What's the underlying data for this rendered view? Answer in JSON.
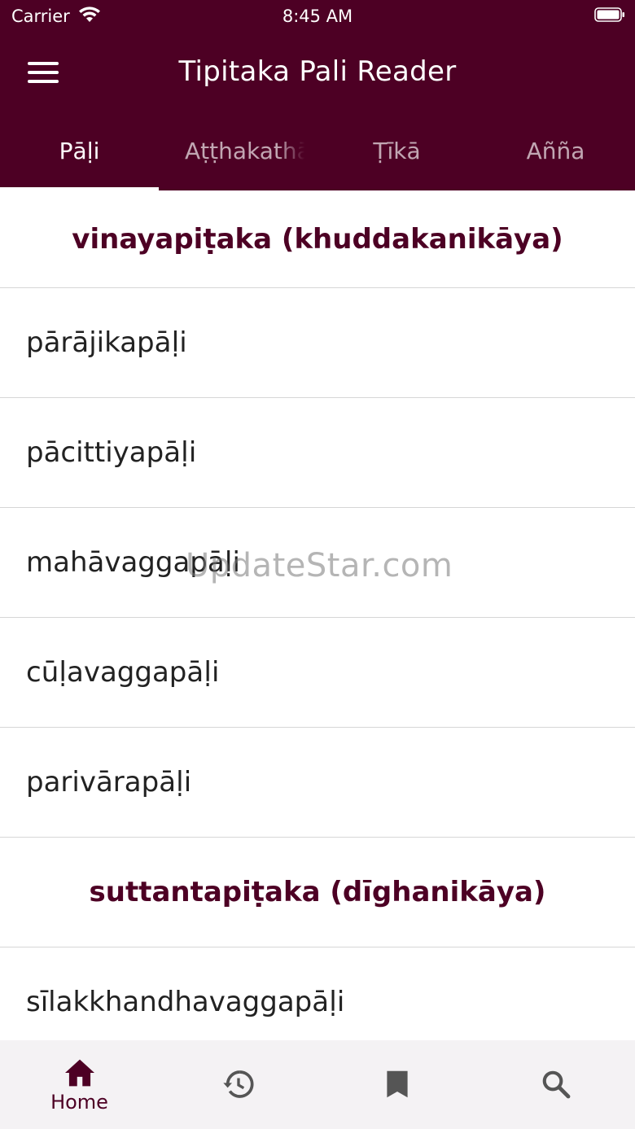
{
  "status_bar": {
    "carrier": "Carrier",
    "time": "8:45 AM",
    "icons": [
      "wifi-icon",
      "battery-icon"
    ]
  },
  "app_bar": {
    "title": "Tipitaka Pali Reader",
    "menu_icon": "hamburger-menu-icon"
  },
  "tabs": [
    {
      "label": "Pāḷi",
      "active": true
    },
    {
      "label": "Aṭṭhakathā",
      "active": false
    },
    {
      "label": "Ṭīkā",
      "active": false
    },
    {
      "label": "Añña",
      "active": false
    }
  ],
  "sections": [
    {
      "header": "vinayapiṭaka (khuddakanikāya)",
      "items": [
        "pārājikapāḷi",
        "pācittiyapāḷi",
        "mahāvaggapāḷi",
        "cūḷavaggapāḷi",
        "parivārapāḷi"
      ]
    },
    {
      "header": "suttantapiṭaka (dīghanikāya)",
      "items": [
        "sīlakkhandhavaggapāḷi"
      ]
    }
  ],
  "watermark": "UpdateStar.com",
  "bottom_nav": {
    "home_label": "Home",
    "icons": [
      "home-icon",
      "history-icon",
      "bookmark-icon",
      "search-icon"
    ]
  },
  "colors": {
    "primary": "#4d0024",
    "nav_background": "#f4f2f4",
    "divider": "#d6d6d6",
    "inactive_icon": "#555555"
  }
}
